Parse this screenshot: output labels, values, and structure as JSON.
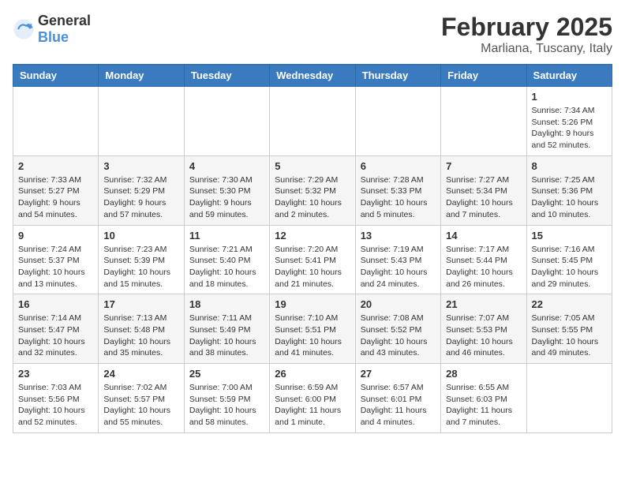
{
  "logo": {
    "general": "General",
    "blue": "Blue"
  },
  "title": "February 2025",
  "location": "Marliana, Tuscany, Italy",
  "weekdays": [
    "Sunday",
    "Monday",
    "Tuesday",
    "Wednesday",
    "Thursday",
    "Friday",
    "Saturday"
  ],
  "weeks": [
    [
      {
        "day": "",
        "info": ""
      },
      {
        "day": "",
        "info": ""
      },
      {
        "day": "",
        "info": ""
      },
      {
        "day": "",
        "info": ""
      },
      {
        "day": "",
        "info": ""
      },
      {
        "day": "",
        "info": ""
      },
      {
        "day": "1",
        "info": "Sunrise: 7:34 AM\nSunset: 5:26 PM\nDaylight: 9 hours and 52 minutes."
      }
    ],
    [
      {
        "day": "2",
        "info": "Sunrise: 7:33 AM\nSunset: 5:27 PM\nDaylight: 9 hours and 54 minutes."
      },
      {
        "day": "3",
        "info": "Sunrise: 7:32 AM\nSunset: 5:29 PM\nDaylight: 9 hours and 57 minutes."
      },
      {
        "day": "4",
        "info": "Sunrise: 7:30 AM\nSunset: 5:30 PM\nDaylight: 9 hours and 59 minutes."
      },
      {
        "day": "5",
        "info": "Sunrise: 7:29 AM\nSunset: 5:32 PM\nDaylight: 10 hours and 2 minutes."
      },
      {
        "day": "6",
        "info": "Sunrise: 7:28 AM\nSunset: 5:33 PM\nDaylight: 10 hours and 5 minutes."
      },
      {
        "day": "7",
        "info": "Sunrise: 7:27 AM\nSunset: 5:34 PM\nDaylight: 10 hours and 7 minutes."
      },
      {
        "day": "8",
        "info": "Sunrise: 7:25 AM\nSunset: 5:36 PM\nDaylight: 10 hours and 10 minutes."
      }
    ],
    [
      {
        "day": "9",
        "info": "Sunrise: 7:24 AM\nSunset: 5:37 PM\nDaylight: 10 hours and 13 minutes."
      },
      {
        "day": "10",
        "info": "Sunrise: 7:23 AM\nSunset: 5:39 PM\nDaylight: 10 hours and 15 minutes."
      },
      {
        "day": "11",
        "info": "Sunrise: 7:21 AM\nSunset: 5:40 PM\nDaylight: 10 hours and 18 minutes."
      },
      {
        "day": "12",
        "info": "Sunrise: 7:20 AM\nSunset: 5:41 PM\nDaylight: 10 hours and 21 minutes."
      },
      {
        "day": "13",
        "info": "Sunrise: 7:19 AM\nSunset: 5:43 PM\nDaylight: 10 hours and 24 minutes."
      },
      {
        "day": "14",
        "info": "Sunrise: 7:17 AM\nSunset: 5:44 PM\nDaylight: 10 hours and 26 minutes."
      },
      {
        "day": "15",
        "info": "Sunrise: 7:16 AM\nSunset: 5:45 PM\nDaylight: 10 hours and 29 minutes."
      }
    ],
    [
      {
        "day": "16",
        "info": "Sunrise: 7:14 AM\nSunset: 5:47 PM\nDaylight: 10 hours and 32 minutes."
      },
      {
        "day": "17",
        "info": "Sunrise: 7:13 AM\nSunset: 5:48 PM\nDaylight: 10 hours and 35 minutes."
      },
      {
        "day": "18",
        "info": "Sunrise: 7:11 AM\nSunset: 5:49 PM\nDaylight: 10 hours and 38 minutes."
      },
      {
        "day": "19",
        "info": "Sunrise: 7:10 AM\nSunset: 5:51 PM\nDaylight: 10 hours and 41 minutes."
      },
      {
        "day": "20",
        "info": "Sunrise: 7:08 AM\nSunset: 5:52 PM\nDaylight: 10 hours and 43 minutes."
      },
      {
        "day": "21",
        "info": "Sunrise: 7:07 AM\nSunset: 5:53 PM\nDaylight: 10 hours and 46 minutes."
      },
      {
        "day": "22",
        "info": "Sunrise: 7:05 AM\nSunset: 5:55 PM\nDaylight: 10 hours and 49 minutes."
      }
    ],
    [
      {
        "day": "23",
        "info": "Sunrise: 7:03 AM\nSunset: 5:56 PM\nDaylight: 10 hours and 52 minutes."
      },
      {
        "day": "24",
        "info": "Sunrise: 7:02 AM\nSunset: 5:57 PM\nDaylight: 10 hours and 55 minutes."
      },
      {
        "day": "25",
        "info": "Sunrise: 7:00 AM\nSunset: 5:59 PM\nDaylight: 10 hours and 58 minutes."
      },
      {
        "day": "26",
        "info": "Sunrise: 6:59 AM\nSunset: 6:00 PM\nDaylight: 11 hours and 1 minute."
      },
      {
        "day": "27",
        "info": "Sunrise: 6:57 AM\nSunset: 6:01 PM\nDaylight: 11 hours and 4 minutes."
      },
      {
        "day": "28",
        "info": "Sunrise: 6:55 AM\nSunset: 6:03 PM\nDaylight: 11 hours and 7 minutes."
      },
      {
        "day": "",
        "info": ""
      }
    ]
  ]
}
